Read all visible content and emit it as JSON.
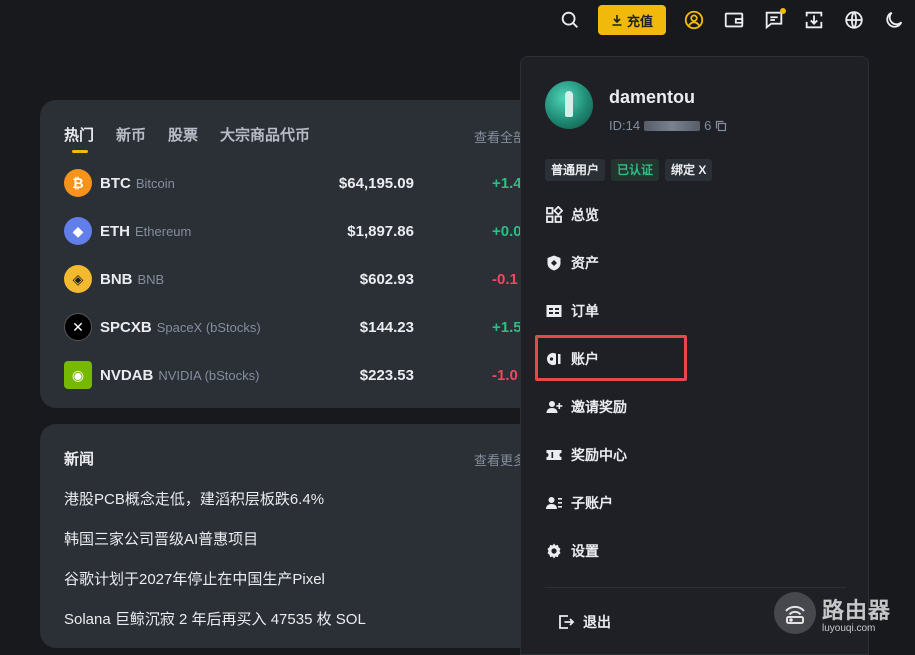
{
  "topbar": {
    "deposit_label": "充值",
    "icons": [
      "search-icon",
      "user-icon",
      "wallet-icon",
      "messages-icon",
      "download-icon",
      "globe-icon",
      "theme-toggle-icon"
    ],
    "accent": "#f0b90b"
  },
  "market": {
    "tabs": [
      {
        "label": "热门",
        "active": true
      },
      {
        "label": "新币",
        "active": false
      },
      {
        "label": "股票",
        "active": false
      },
      {
        "label": "大宗商品代币",
        "active": false
      }
    ],
    "view_all": "查看全部",
    "coins": [
      {
        "symbol": "BTC",
        "name": "Bitcoin",
        "price": "$64,195.09",
        "change": "+1.4",
        "trend": "up",
        "color": "#f7931a",
        "glyph": "₿"
      },
      {
        "symbol": "ETH",
        "name": "Ethereum",
        "price": "$1,897.86",
        "change": "+0.0",
        "trend": "up",
        "color": "#627eea",
        "glyph": "◆"
      },
      {
        "symbol": "BNB",
        "name": "BNB",
        "price": "$602.93",
        "change": "-0.1",
        "trend": "down",
        "color": "#f3ba2f",
        "glyph": "◈"
      },
      {
        "symbol": "SPCXB",
        "name": "SpaceX (bStocks)",
        "price": "$144.23",
        "change": "+1.5",
        "trend": "up",
        "color": "#000000",
        "glyph": "✕"
      },
      {
        "symbol": "NVDAB",
        "name": "NVIDIA (bStocks)",
        "price": "$223.53",
        "change": "-1.0",
        "trend": "down",
        "color": "#76b900",
        "glyph": "◉"
      }
    ]
  },
  "news": {
    "title": "新闻",
    "more": "查看更多",
    "items": [
      "港股PCB概念走低，建滔积层板跌6.4%",
      "韩国三家公司晋级AI普惠项目",
      "谷歌计划于2027年停止在中国生产Pixel",
      "Solana 巨鲸沉寂 2 年后再买入 47535 枚 SOL"
    ]
  },
  "account_menu": {
    "username": "damentou",
    "uid_prefix": "ID:14",
    "uid_suffix": "6",
    "badges": [
      "普通用户",
      "已认证",
      "绑定 X"
    ],
    "items": [
      {
        "label": "总览",
        "icon": "dashboard-icon"
      },
      {
        "label": "资产",
        "icon": "assets-icon"
      },
      {
        "label": "订单",
        "icon": "orders-icon"
      },
      {
        "label": "账户",
        "icon": "account-icon",
        "highlighted": true
      },
      {
        "label": "邀请奖励",
        "icon": "referral-icon"
      },
      {
        "label": "奖励中心",
        "icon": "reward-icon"
      },
      {
        "label": "子账户",
        "icon": "sub-account-icon"
      },
      {
        "label": "设置",
        "icon": "settings-icon"
      }
    ],
    "logout": "退出"
  },
  "watermark": {
    "name": "路由器",
    "url": "luyouqi.com"
  }
}
